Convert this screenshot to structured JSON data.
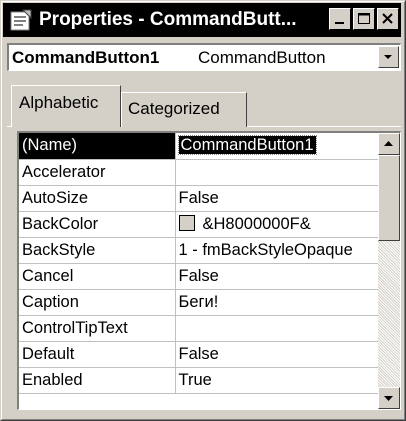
{
  "window": {
    "title": "Properties - CommandButt...",
    "icons": {
      "app": "properties-window-icon",
      "minimize": "minimize-icon",
      "maximize": "maximize-icon",
      "close": "close-icon"
    }
  },
  "object_selector": {
    "name": "CommandButton1",
    "type": "CommandButton",
    "icon": "chevron-down-icon"
  },
  "tabs": [
    {
      "label": "Alphabetic",
      "active": true
    },
    {
      "label": "Categorized",
      "active": false
    }
  ],
  "properties": [
    {
      "name": "(Name)",
      "value": "CommandButton1",
      "selected": true
    },
    {
      "name": "Accelerator",
      "value": ""
    },
    {
      "name": "AutoSize",
      "value": "False"
    },
    {
      "name": "BackColor",
      "value": "&H8000000F&",
      "swatch_color": "#d4d0c8"
    },
    {
      "name": "BackStyle",
      "value": "1 - fmBackStyleOpaque"
    },
    {
      "name": "Cancel",
      "value": "False"
    },
    {
      "name": "Caption",
      "value": "Беги!"
    },
    {
      "name": "ControlTipText",
      "value": ""
    },
    {
      "name": "Default",
      "value": "False"
    },
    {
      "name": "Enabled",
      "value": "True"
    }
  ],
  "colors": {
    "titlebar": "#000000",
    "face": "#d4d0c8",
    "selection": "#000000"
  }
}
